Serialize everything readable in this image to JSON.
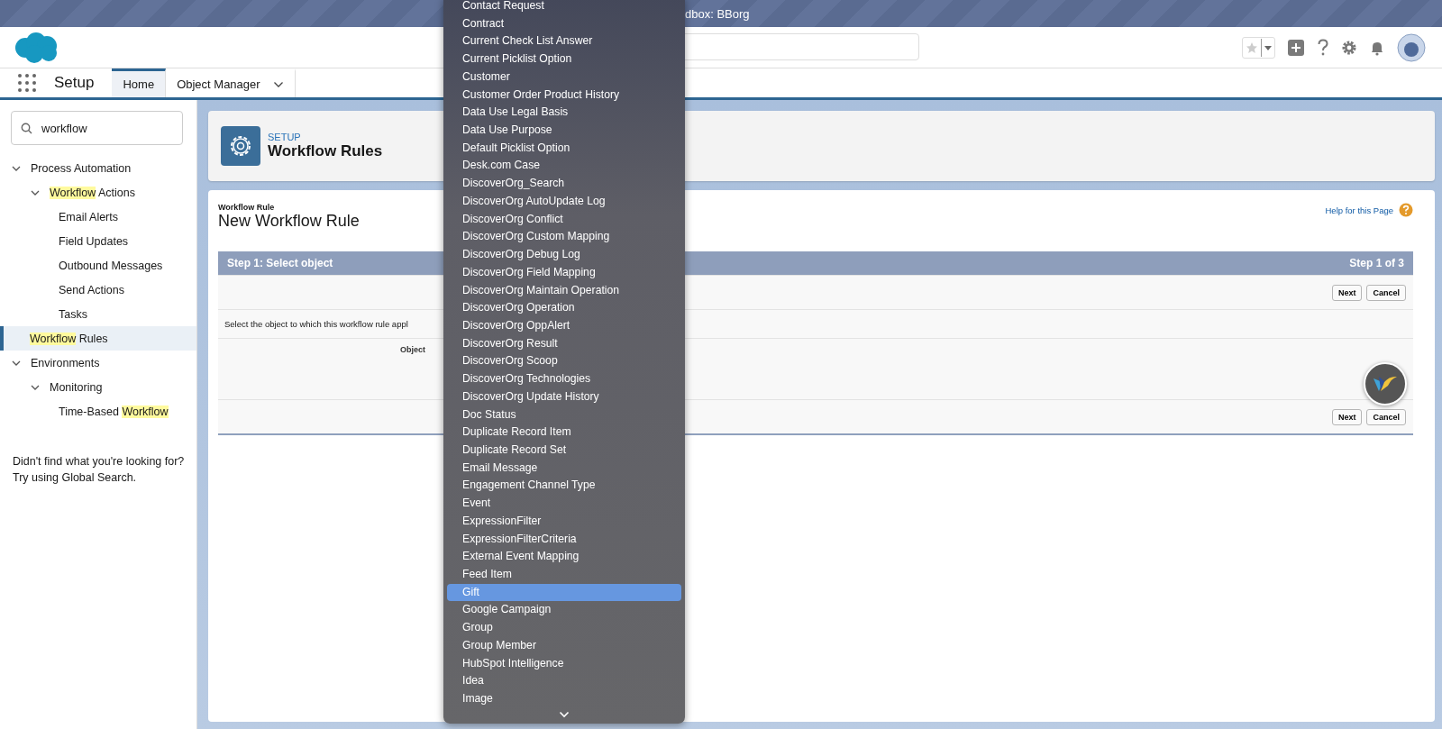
{
  "title_bar": {
    "text": "dbox: BBorg"
  },
  "nav": {
    "app_name": "Setup",
    "tabs": [
      {
        "label": "Home",
        "selected": true,
        "menu": false
      },
      {
        "label": "Object Manager",
        "selected": false,
        "menu": true
      }
    ]
  },
  "sidebar": {
    "search": {
      "value": "workflow"
    },
    "tree": [
      {
        "label": [
          {
            "text": "Process Automation",
            "highlighted": false
          }
        ],
        "selected": false,
        "expanded": true,
        "children": [
          {
            "label": [
              {
                "text": "Workflow",
                "highlighted": true
              },
              {
                "text": " Actions",
                "highlighted": false
              }
            ],
            "selected": false,
            "expanded": true,
            "children": [
              {
                "label": [
                  {
                    "text": "Email Alerts",
                    "highlighted": false
                  }
                ],
                "selected": false
              },
              {
                "label": [
                  {
                    "text": "Field Updates",
                    "highlighted": false
                  }
                ],
                "selected": false
              },
              {
                "label": [
                  {
                    "text": "Outbound Messages",
                    "highlighted": false
                  }
                ],
                "selected": false
              },
              {
                "label": [
                  {
                    "text": "Send Actions",
                    "highlighted": false
                  }
                ],
                "selected": false
              },
              {
                "label": [
                  {
                    "text": "Tasks",
                    "highlighted": false
                  }
                ],
                "selected": false
              }
            ]
          },
          {
            "label": [
              {
                "text": "Workflow",
                "highlighted": true
              },
              {
                "text": " Rules",
                "highlighted": false
              }
            ],
            "selected": true
          }
        ]
      },
      {
        "label": [
          {
            "text": "Environments",
            "highlighted": false
          }
        ],
        "selected": false,
        "expanded": true,
        "children": [
          {
            "label": [
              {
                "text": "Monitoring",
                "highlighted": false
              }
            ],
            "selected": false,
            "expanded": true,
            "children": [
              {
                "label": [
                  {
                    "text": "Time-Based ",
                    "highlighted": false
                  },
                  {
                    "text": "Workflow",
                    "highlighted": true
                  }
                ],
                "selected": false
              }
            ]
          }
        ]
      }
    ],
    "footer": [
      "Didn't find what you're looking for?",
      "Try using Global Search."
    ]
  },
  "header_card": {
    "eyebrow": "SETUP",
    "title": "Workflow Rules"
  },
  "page": {
    "breadcrumb": "Workflow Rule",
    "title": "New Workflow Rule",
    "help_link": "Help for this Page",
    "step": {
      "title": "Step 1: Select object",
      "counter": "Step 1 of 3",
      "top_buttons": [
        "Next",
        "Cancel"
      ],
      "instruction": "Select the object to which this workflow rule appl",
      "field_label": "Object",
      "bottom_buttons": [
        "Next",
        "Cancel"
      ]
    }
  },
  "dropdown": {
    "items": [
      {
        "label": "Contact Request",
        "selected": false
      },
      {
        "label": "Contract",
        "selected": false
      },
      {
        "label": "Current Check List Answer",
        "selected": false
      },
      {
        "label": "Current Picklist Option",
        "selected": false
      },
      {
        "label": "Customer",
        "selected": false
      },
      {
        "label": "Customer Order Product History",
        "selected": false
      },
      {
        "label": "Data Use Legal Basis",
        "selected": false
      },
      {
        "label": "Data Use Purpose",
        "selected": false
      },
      {
        "label": "Default Picklist Option",
        "selected": false
      },
      {
        "label": "Desk.com Case",
        "selected": false
      },
      {
        "label": "DiscoverOrg_Search",
        "selected": false
      },
      {
        "label": "DiscoverOrg AutoUpdate Log",
        "selected": false
      },
      {
        "label": "DiscoverOrg Conflict",
        "selected": false
      },
      {
        "label": "DiscoverOrg Custom Mapping",
        "selected": false
      },
      {
        "label": "DiscoverOrg Debug Log",
        "selected": false
      },
      {
        "label": "DiscoverOrg Field Mapping",
        "selected": false
      },
      {
        "label": "DiscoverOrg Maintain Operation",
        "selected": false
      },
      {
        "label": "DiscoverOrg Operation",
        "selected": false
      },
      {
        "label": "DiscoverOrg OppAlert",
        "selected": false
      },
      {
        "label": "DiscoverOrg Result",
        "selected": false
      },
      {
        "label": "DiscoverOrg Scoop",
        "selected": false
      },
      {
        "label": "DiscoverOrg Technologies",
        "selected": false
      },
      {
        "label": "DiscoverOrg Update History",
        "selected": false
      },
      {
        "label": "Doc Status",
        "selected": false
      },
      {
        "label": "Duplicate Record Item",
        "selected": false
      },
      {
        "label": "Duplicate Record Set",
        "selected": false
      },
      {
        "label": "Email Message",
        "selected": false
      },
      {
        "label": "Engagement Channel Type",
        "selected": false
      },
      {
        "label": "Event",
        "selected": false
      },
      {
        "label": "ExpressionFilter",
        "selected": false
      },
      {
        "label": "ExpressionFilterCriteria",
        "selected": false
      },
      {
        "label": "External Event Mapping",
        "selected": false
      },
      {
        "label": "Feed Item",
        "selected": false
      },
      {
        "label": "Gift",
        "selected": true
      },
      {
        "label": "Google Campaign",
        "selected": false
      },
      {
        "label": "Group",
        "selected": false
      },
      {
        "label": "Group Member",
        "selected": false
      },
      {
        "label": "HubSpot Intelligence",
        "selected": false
      },
      {
        "label": "Idea",
        "selected": false
      },
      {
        "label": "Image",
        "selected": false
      }
    ]
  }
}
